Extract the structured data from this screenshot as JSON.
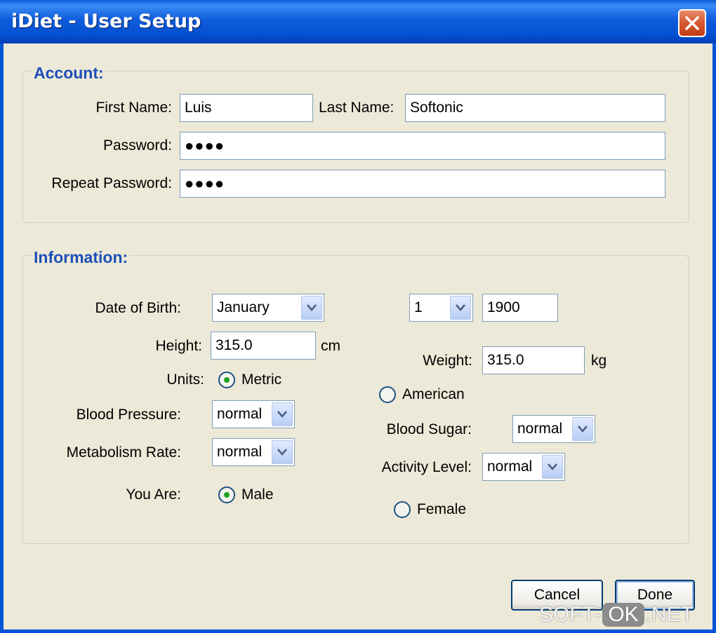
{
  "window": {
    "title": "iDiet - User Setup"
  },
  "account": {
    "legend": "Account:",
    "first_name_label": "First Name:",
    "first_name_value": "Luis",
    "last_name_label": "Last Name:",
    "last_name_value": "Softonic",
    "password_label": "Password:",
    "password_value": "●●●●",
    "repeat_password_label": "Repeat Password:",
    "repeat_password_value": "●●●●"
  },
  "information": {
    "legend": "Information:",
    "dob_label": "Date of Birth:",
    "dob_month": "January",
    "dob_day": "1",
    "dob_year": "1900",
    "height_label": "Height:",
    "height_value": "315.0",
    "height_unit": "cm",
    "weight_label": "Weight:",
    "weight_value": "315.0",
    "weight_unit": "kg",
    "units_label": "Units:",
    "units_metric": "Metric",
    "units_american": "American",
    "units_selected": "Metric",
    "blood_pressure_label": "Blood Pressure:",
    "blood_pressure_value": "normal",
    "blood_sugar_label": "Blood Sugar:",
    "blood_sugar_value": "normal",
    "metabolism_label": "Metabolism Rate:",
    "metabolism_value": "normal",
    "activity_label": "Activity Level:",
    "activity_value": "normal",
    "gender_label": "You Are:",
    "gender_male": "Male",
    "gender_female": "Female",
    "gender_selected": "Male"
  },
  "buttons": {
    "cancel": "Cancel",
    "done": "Done"
  },
  "watermark": {
    "left": "SOFT-",
    "middle": "OK",
    "right": ".NET"
  },
  "colors": {
    "titlebar": "#0450d0",
    "legend": "#1d4fb8",
    "background": "#ece9d8",
    "radio_selected": "#21a121"
  }
}
